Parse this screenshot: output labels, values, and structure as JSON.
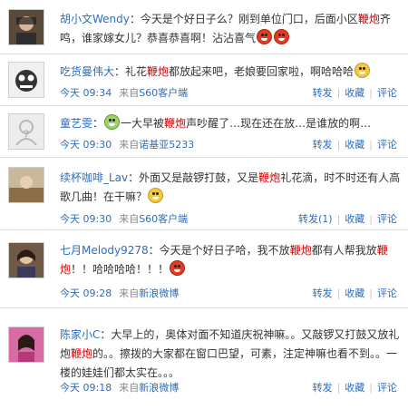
{
  "posts": [
    {
      "user": "胡小文Wendy",
      "segments": [
        "：今天是个好日子么？刚到单位门口，后面小区",
        "鞭炮",
        "齐鸣，谁家嫁女儿？恭喜恭喜啊！沾沾喜气"
      ],
      "emoticons": [
        "laugh",
        "laugh"
      ],
      "time": "",
      "source_prefix": "",
      "source": ""
    },
    {
      "user": "吃货曼伟大",
      "segments": [
        "：礼花",
        "鞭炮",
        "都放起来吧，老娘要回家啦，啊哈哈哈"
      ],
      "emoticons": [
        "shy"
      ],
      "time": "今天 09:34",
      "source_prefix": "来自",
      "source": "S60客户端",
      "actions": [
        "转发",
        "收藏",
        "评论"
      ]
    },
    {
      "user": "童艺雯",
      "segments": [
        "一大早被",
        "鞭炮",
        "声吵醒了…现在还在放…是谁放的啊…"
      ],
      "emoticons": [
        "cry"
      ],
      "time": "今天 09:30",
      "source_prefix": "来自",
      "source": "诺基亚5233",
      "actions": [
        "转发",
        "收藏",
        "评论"
      ]
    },
    {
      "user": "续杯咖啡_Lav",
      "segments": [
        "：外面又是敲锣打鼓，又是",
        "鞭炮",
        "礼花滴，时不时还有人高歌几曲！在干嘛？"
      ],
      "emoticons": [
        "question"
      ],
      "time": "今天 09:30",
      "source_prefix": "来自",
      "source": "S60客户端",
      "actions": [
        "转发(1)",
        "收藏",
        "评论"
      ]
    },
    {
      "user": "七月Melody9278",
      "segments": [
        "：今天是个好日子哈，我不放",
        "鞭炮",
        "都有人帮我放",
        "鞭炮",
        "！！哈哈哈哈！！！"
      ],
      "emoticons": [
        "laugh"
      ],
      "time": "今天 09:28",
      "source_prefix": "来自",
      "source": "新浪微博",
      "actions": [
        "转发",
        "收藏",
        "评论"
      ]
    },
    {
      "user": "陈家小C",
      "segments": [
        "：大早上的，奥体对面不知道庆祝神嘛。。又敲锣又打鼓又放礼炮",
        "鞭炮",
        "的。。擦拨的大家都在窗口巴望，可素，注定神嘛也看不到。。一楼的娃娃们都太实在。。。"
      ],
      "emoticons": [],
      "time": "今天 09:18",
      "source_prefix": "来自",
      "source": "新浪微博",
      "actions": [
        "转发",
        "收藏",
        "评论"
      ]
    }
  ]
}
